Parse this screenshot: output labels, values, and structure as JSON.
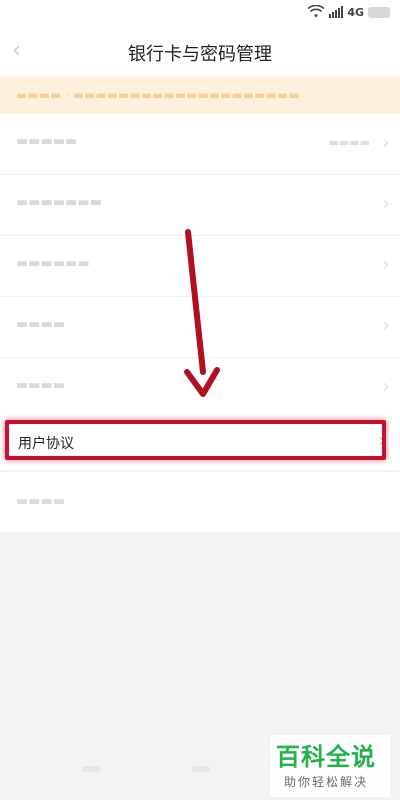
{
  "status_bar": {
    "network": "4G"
  },
  "nav": {
    "title": "银行卡与密码管理"
  },
  "highlighted_item": {
    "label": "用户协议"
  },
  "watermark": {
    "main": "百科全说",
    "sub": "助你轻松解决"
  },
  "colors": {
    "highlight": "#c8102e",
    "watermark_green": "#22b14c",
    "notice_bg": "#fdf1dd"
  }
}
